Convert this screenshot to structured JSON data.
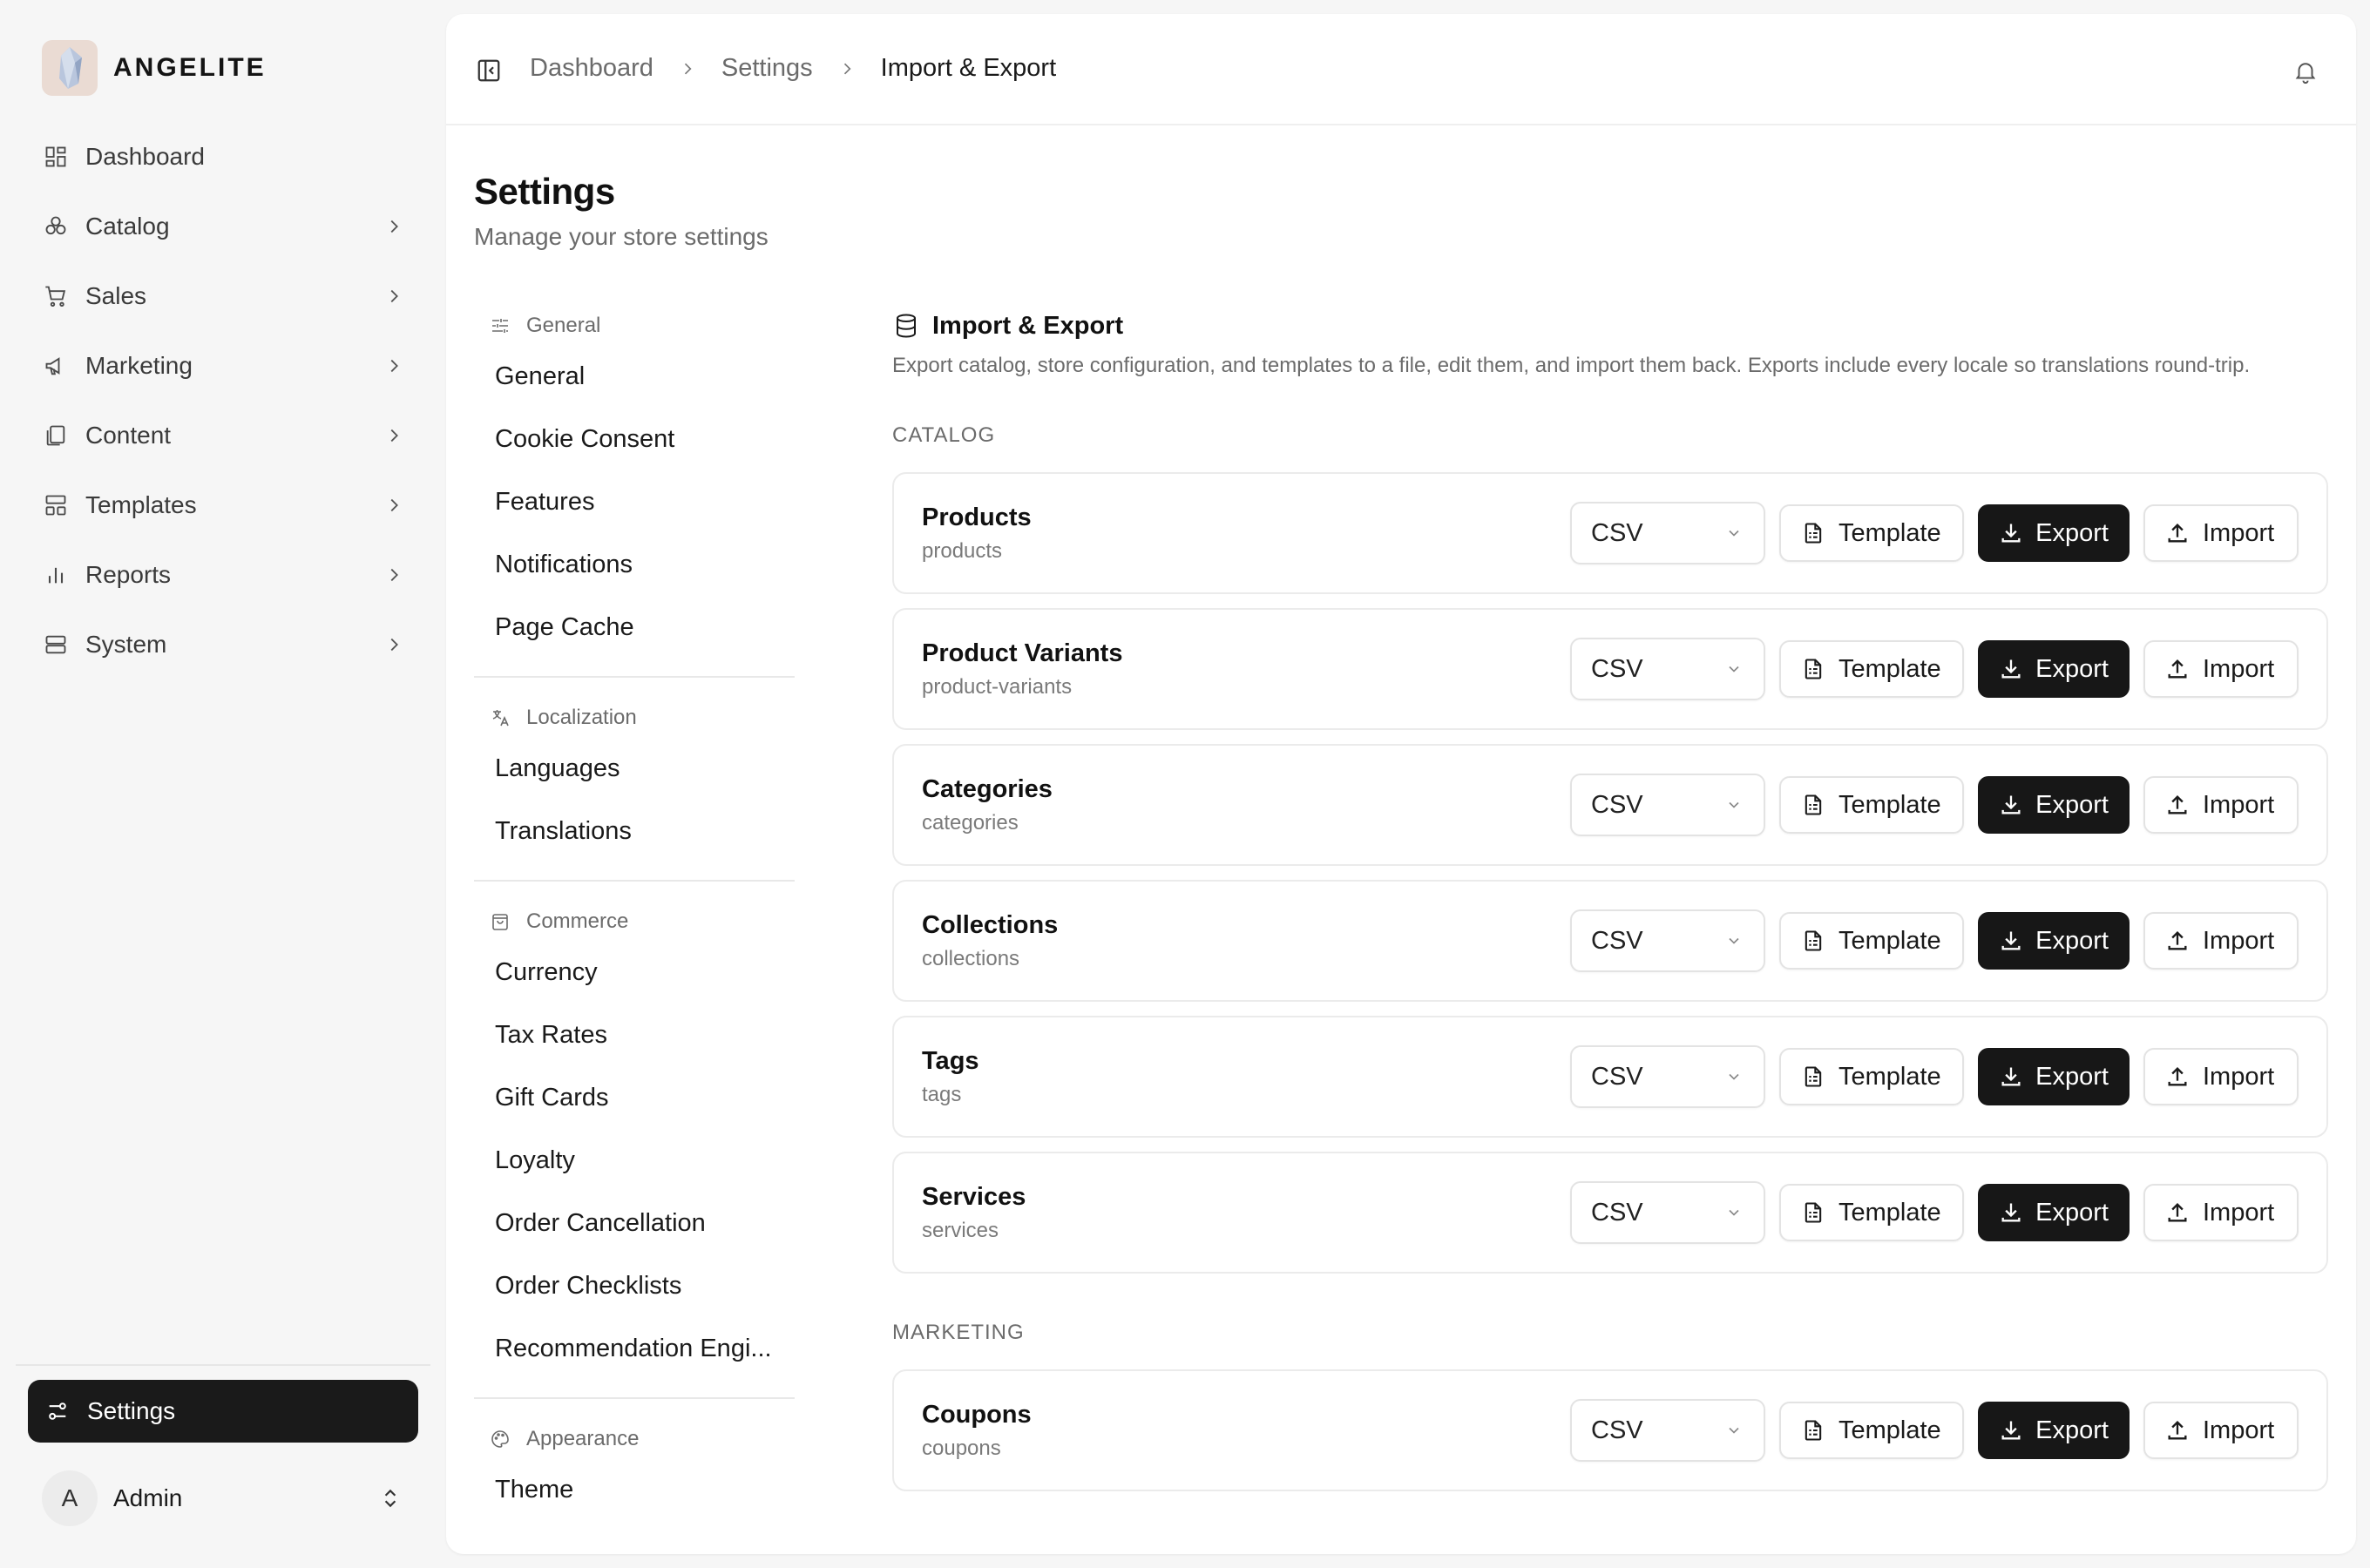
{
  "brand": {
    "name": "ANGELITE"
  },
  "sidebar": {
    "items": [
      {
        "label": "Dashboard",
        "icon": "dashboard-icon",
        "has_children": false
      },
      {
        "label": "Catalog",
        "icon": "catalog-icon",
        "has_children": true
      },
      {
        "label": "Sales",
        "icon": "cart-icon",
        "has_children": true
      },
      {
        "label": "Marketing",
        "icon": "megaphone-icon",
        "has_children": true
      },
      {
        "label": "Content",
        "icon": "content-icon",
        "has_children": true
      },
      {
        "label": "Templates",
        "icon": "templates-icon",
        "has_children": true
      },
      {
        "label": "Reports",
        "icon": "reports-icon",
        "has_children": true
      },
      {
        "label": "System",
        "icon": "system-icon",
        "has_children": true
      }
    ],
    "settings_label": "Settings",
    "user": {
      "initial": "A",
      "name": "Admin"
    }
  },
  "header": {
    "breadcrumbs": [
      "Dashboard",
      "Settings",
      "Import & Export"
    ]
  },
  "page": {
    "title": "Settings",
    "subtitle": "Manage your store settings"
  },
  "subnav": {
    "groups": [
      {
        "label": "General",
        "icon": "sliders-icon",
        "items": [
          "General",
          "Cookie Consent",
          "Features",
          "Notifications",
          "Page Cache"
        ]
      },
      {
        "label": "Localization",
        "icon": "translate-icon",
        "items": [
          "Languages",
          "Translations"
        ]
      },
      {
        "label": "Commerce",
        "icon": "shopping-bag-icon",
        "items": [
          "Currency",
          "Tax Rates",
          "Gift Cards",
          "Loyalty",
          "Order Cancellation",
          "Order Checklists",
          "Recommendation Engi..."
        ]
      },
      {
        "label": "Appearance",
        "icon": "palette-icon",
        "items": [
          "Theme"
        ]
      }
    ]
  },
  "section": {
    "title": "Import & Export",
    "description": "Export catalog, store configuration, and templates to a file, edit them, and import them back. Exports include every locale so translations round-trip."
  },
  "buttons": {
    "template": "Template",
    "export": "Export",
    "import": "Import"
  },
  "groups": {
    "catalog": {
      "label": "CATALOG",
      "rows": [
        {
          "name": "Products",
          "key": "products",
          "format": "CSV"
        },
        {
          "name": "Product Variants",
          "key": "product-variants",
          "format": "CSV"
        },
        {
          "name": "Categories",
          "key": "categories",
          "format": "CSV"
        },
        {
          "name": "Collections",
          "key": "collections",
          "format": "CSV"
        },
        {
          "name": "Tags",
          "key": "tags",
          "format": "CSV"
        },
        {
          "name": "Services",
          "key": "services",
          "format": "CSV"
        }
      ]
    },
    "marketing": {
      "label": "MARKETING",
      "rows": [
        {
          "name": "Coupons",
          "key": "coupons",
          "format": "CSV"
        }
      ]
    }
  },
  "colors": {
    "primary": "#171717",
    "muted_text": "#6b6b6b",
    "border": "#ebebeb",
    "background": "#f6f6f6"
  }
}
